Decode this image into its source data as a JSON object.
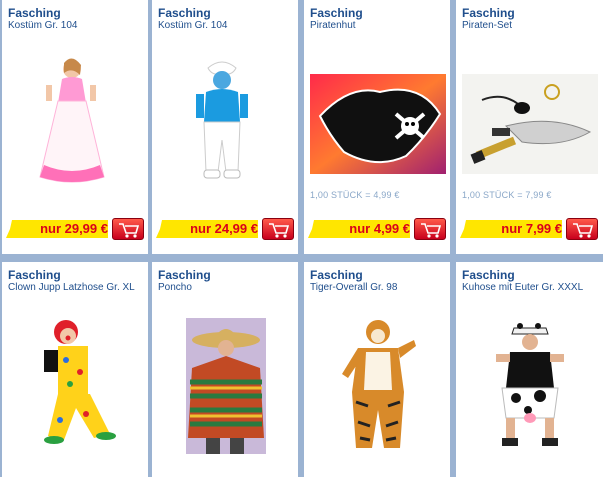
{
  "products": [
    {
      "category": "Fasching",
      "name": "Kostüm Gr. 104",
      "unit": "",
      "price": "nur 29,99 €",
      "image": "princess-costume-image"
    },
    {
      "category": "Fasching",
      "name": "Kostüm Gr. 104",
      "unit": "",
      "price": "nur 24,99 €",
      "image": "smurf-costume-image"
    },
    {
      "category": "Fasching",
      "name": "Piratenhut",
      "unit": "1,00 STÜCK = 4,99 €",
      "price": "nur 4,99 €",
      "image": "pirate-hat-image"
    },
    {
      "category": "Fasching",
      "name": "Piraten-Set",
      "unit": "1,00 STÜCK = 7,99 €",
      "price": "nur 7,99 €",
      "image": "pirate-set-image"
    },
    {
      "category": "Fasching",
      "name": "Clown Jupp Latzhose Gr. XL",
      "unit": "",
      "price": "",
      "image": "clown-costume-image"
    },
    {
      "category": "Fasching",
      "name": "Poncho",
      "unit": "",
      "price": "",
      "image": "poncho-image"
    },
    {
      "category": "Fasching",
      "name": "Tiger-Overall Gr. 98",
      "unit": "",
      "price": "",
      "image": "tiger-overall-image"
    },
    {
      "category": "Fasching",
      "name": "Kuhose mit Euter Gr. XXXL",
      "unit": "",
      "price": "",
      "image": "cow-costume-image"
    }
  ],
  "colors": {
    "background": "#9bb3d2",
    "text": "#1f4e8c",
    "price_ribbon": "#ffe600",
    "price_text": "#d9001a",
    "cart_button": "#d9001a"
  }
}
